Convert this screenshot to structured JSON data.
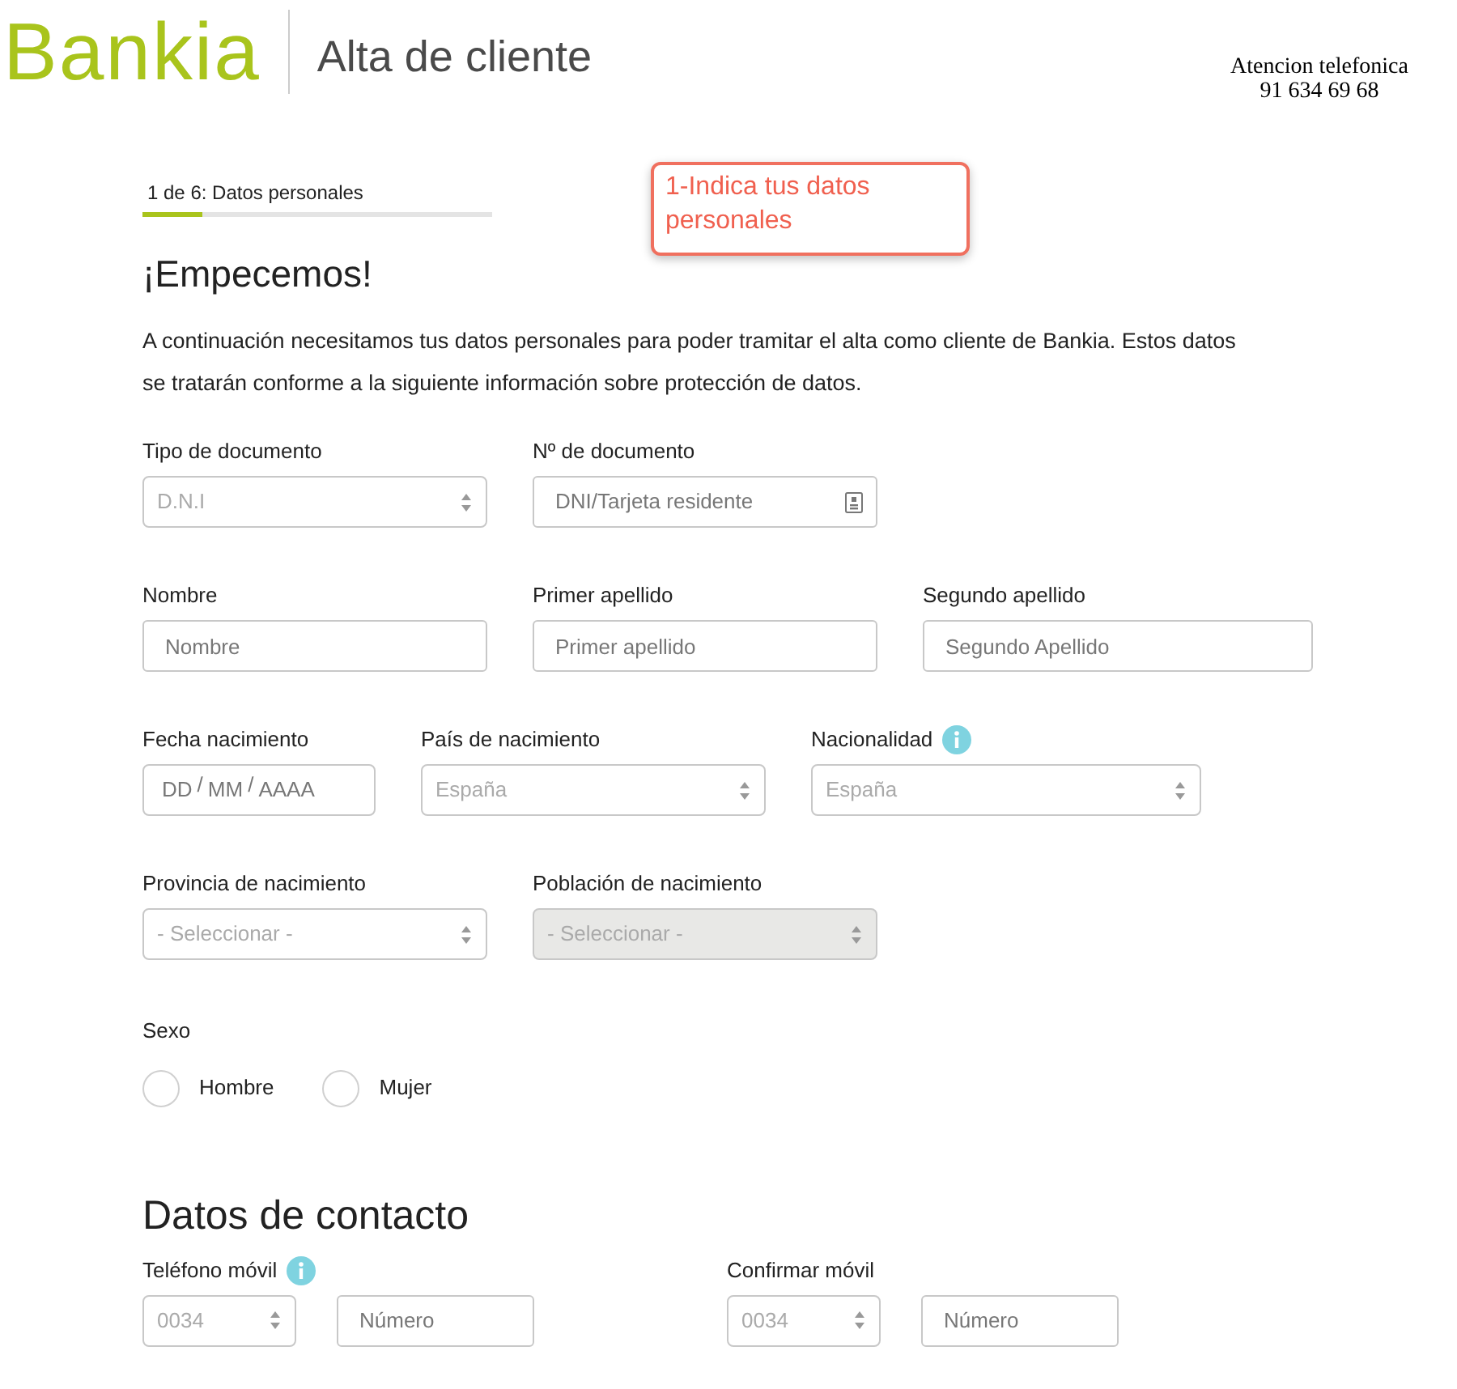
{
  "header": {
    "logo": "Bankia",
    "title": "Alta de cliente",
    "phone_label": "Atencion telefonica",
    "phone": "91 634 69 68"
  },
  "progress": {
    "step": "1 de 6: Datos personales",
    "level": 0.17
  },
  "callout": {
    "text": "1-Indica tus datos personales"
  },
  "heading": "¡Empecemos!",
  "intro": "A continuación necesitamos tus datos personales para poder tramitar el alta como cliente de Bankia. Estos datos se tratarán conforme a la siguiente información sobre protección de datos.",
  "rows": [
    [
      {
        "kind": "select",
        "label": "Tipo de documento",
        "value": "D.N.I",
        "disabled": false,
        "info": false
      },
      {
        "kind": "document",
        "label": "Nº de documento",
        "placeholder": "DNI/Tarjeta residente",
        "info": false
      }
    ],
    [
      {
        "kind": "text",
        "label": "Nombre",
        "placeholder": "Nombre",
        "info": false
      },
      {
        "kind": "text",
        "label": "Primer apellido",
        "placeholder": "Primer apellido",
        "info": false
      },
      {
        "kind": "text",
        "label": "Segundo apellido",
        "placeholder": "Segundo Apellido",
        "info": false
      }
    ],
    [
      {
        "kind": "date",
        "label": "Fecha nacimiento",
        "parts": [
          "DD",
          "MM",
          "AAAA"
        ],
        "separator": "/",
        "info": false
      },
      {
        "kind": "select",
        "label": "País de nacimiento",
        "value": "España",
        "disabled": false,
        "info": false
      },
      {
        "kind": "select",
        "label": "Nacionalidad",
        "value": "España",
        "disabled": false,
        "info": true
      }
    ],
    [
      {
        "kind": "select",
        "label": "Provincia de nacimiento",
        "value": "- Seleccionar -",
        "disabled": false,
        "info": false
      },
      {
        "kind": "select",
        "label": "Población de nacimiento",
        "value": "- Seleccionar -",
        "disabled": true,
        "info": false
      }
    ]
  ],
  "sex": {
    "label": "Sexo",
    "options": [
      {
        "label": "Hombre",
        "selected": false
      },
      {
        "label": "Mujer",
        "selected": false
      }
    ]
  },
  "contact": {
    "heading": "Datos de contacto",
    "phones": [
      {
        "label": "Teléfono móvil",
        "info": true,
        "prefix": "0034",
        "placeholder": "Número"
      },
      {
        "label": "Confirmar móvil",
        "info": false,
        "prefix": "0034",
        "placeholder": "Número"
      }
    ]
  }
}
